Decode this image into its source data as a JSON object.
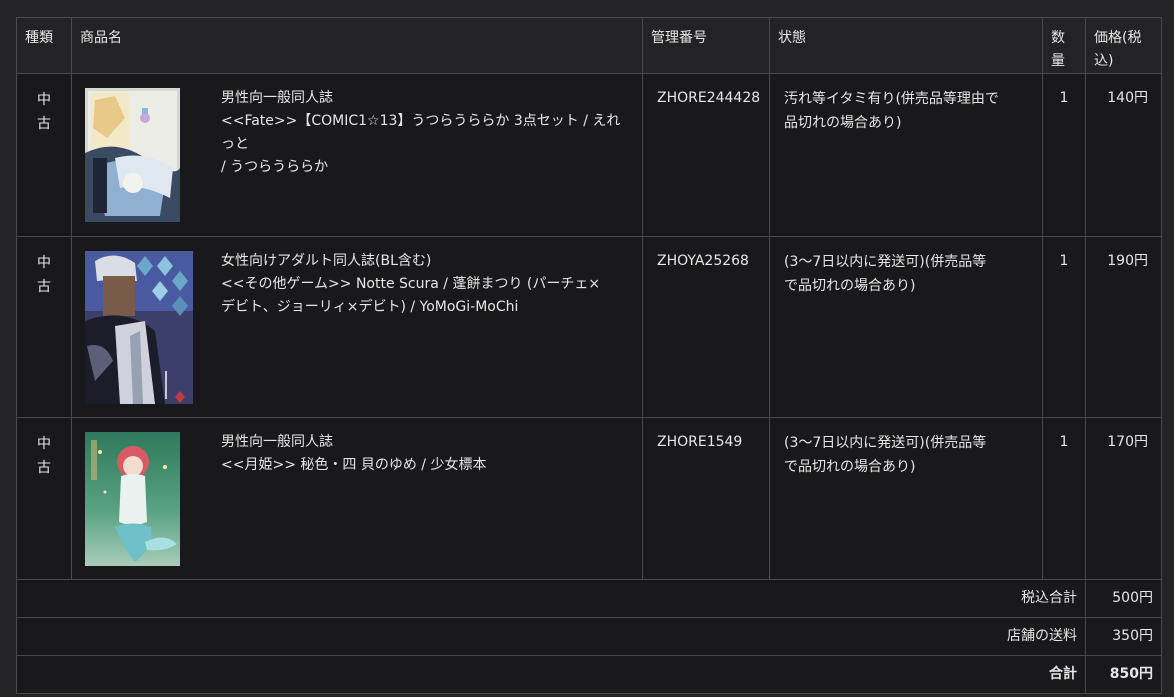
{
  "headers": {
    "kind": "種類",
    "product": "商品名",
    "mgmt": "管理番号",
    "status": "状態",
    "qty_line1": "数",
    "qty_line2": "量",
    "price_line1": "価格(税",
    "price_line2": "込)"
  },
  "items": [
    {
      "kind_line1": "中",
      "kind_line2": "古",
      "category": "男性向一般同人誌",
      "title_line1": "<<Fate>>【COMIC1☆13】うつらうららか 3点セット / えれっと",
      "title_line2": "/ うつらうららか",
      "title_line3": "",
      "mgmt_no": "ZHORE244428",
      "status_line1": "汚れ等イタミ有り(併売品等理由で",
      "status_line2": "品切れの場合あり)",
      "qty": "1",
      "price": "140円",
      "cover_icon": "book-cover-fate"
    },
    {
      "kind_line1": "中",
      "kind_line2": "古",
      "category": "女性向けアダルト同人誌(BL含む)",
      "title_line1": "<<その他ゲーム>> Notte Scura / 蓬餅まつり (パーチェ×",
      "title_line2": "デビト、ジョーリィ×デビト) / YoMoGi-MoChi",
      "title_line3": "",
      "mgmt_no": "ZHOYA25268",
      "status_line1": "(3〜7日以内に発送可)(併売品等",
      "status_line2": "で品切れの場合あり)",
      "qty": "1",
      "price": "190円",
      "cover_icon": "book-cover-notte-scura"
    },
    {
      "kind_line1": "中",
      "kind_line2": "古",
      "category": "男性向一般同人誌",
      "title_line1": "<<月姫>> 秘色・四 貝のゆめ / 少女標本",
      "title_line2": "",
      "title_line3": "",
      "mgmt_no": "ZHORE1549",
      "status_line1": "(3〜7日以内に発送可)(併売品等",
      "status_line2": "で品切れの場合あり)",
      "qty": "1",
      "price": "170円",
      "cover_icon": "book-cover-kai-no-yume"
    }
  ],
  "summary": {
    "subtotal_label": "税込合計",
    "subtotal_value": "500円",
    "shipping_label": "店舗の送料",
    "shipping_value": "350円",
    "total_label": "合計",
    "total_value": "850円"
  },
  "colors": {
    "background": "#232325",
    "row_background": "#19191b",
    "border": "#4a4a4d",
    "text": "#e6e6e6"
  }
}
